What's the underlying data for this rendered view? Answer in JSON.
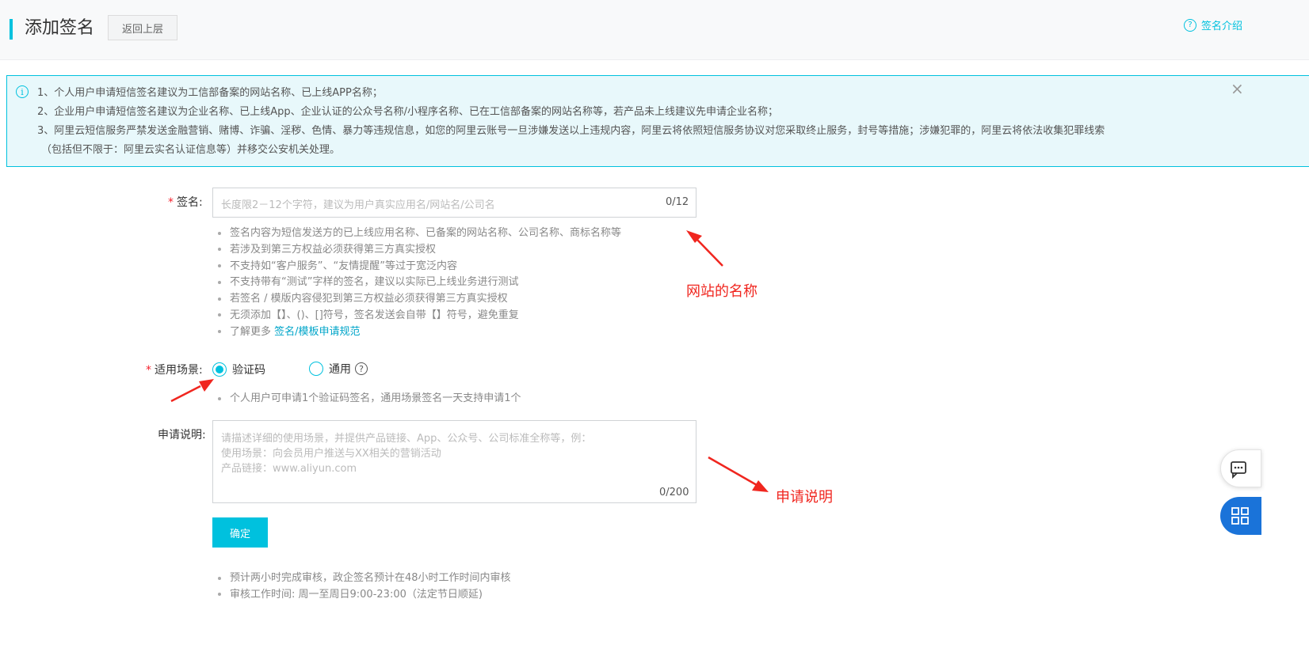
{
  "header": {
    "title": "添加签名",
    "back_label": "返回上层",
    "intro_icon": "question-circle-icon",
    "intro_label": "签名介绍"
  },
  "notice": {
    "lines": [
      "1、个人用户申请短信签名建议为工信部备案的网站名称、已上线APP名称；",
      "2、企业用户申请短信签名建议为企业名称、已上线App、企业认证的公众号名称/小程序名称、已在工信部备案的网站名称等，若产品未上线建议先申请企业名称；",
      "3、阿里云短信服务严禁发送金融营销、赌博、诈骗、淫秽、色情、暴力等违规信息，如您的阿里云账号一旦涉嫌发送以上违规内容，阿里云将依照短信服务协议对您采取终止服务，封号等措施；涉嫌犯罪的，阿里云将依法收集犯罪线索",
      "（包括但不限于：阿里云实名认证信息等）并移交公安机关处理。"
    ],
    "info_icon": "i",
    "close_icon": "×"
  },
  "form": {
    "required_mark": "*",
    "signature": {
      "label": "签名:",
      "placeholder": "长度限2－12个字符，建议为用户真实应用名/网站名/公司名",
      "counter": "0/12",
      "tips": [
        "签名内容为短信发送方的已上线应用名称、已备案的网站名称、公司名称、商标名称等",
        "若涉及到第三方权益必须获得第三方真实授权",
        "不支持如“客户服务”、“友情提醒”等过于宽泛内容",
        "不支持带有“测试”字样的签名，建议以实际已上线业务进行测试",
        "若签名 / 模版内容侵犯到第三方权益必须获得第三方真实授权",
        "无须添加【】、()、[]符号，签名发送会自带【】符号，避免重复"
      ],
      "more_prefix": "了解更多 ",
      "more_link": "签名/模板申请规范"
    },
    "scene": {
      "label": "适用场景:",
      "option1": "验证码",
      "option2": "通用",
      "help": "?",
      "tip": "个人用户可申请1个验证码签名，通用场景签名一天支持申请1个"
    },
    "description": {
      "label": "申请说明:",
      "placeholder_lines": [
        "请描述详细的使用场景，并提供产品链接、App、公众号、公司标准全称等，例：",
        "使用场景：向会员用户推送与XX相关的营销活动",
        "产品链接：www.aliyun.com"
      ],
      "counter": "0/200"
    },
    "confirm_label": "确定",
    "bottom_tips": [
      "预计两小时完成审核，政企签名预计在48小时工作时间内审核",
      "审核工作时间: 周一至周日9:00-23:00（法定节日顺延)"
    ]
  },
  "annotations": {
    "site_name": "网站的名称",
    "apply_desc": "申请说明"
  },
  "colors": {
    "accent": "#00c1de",
    "annotation": "#f0261f",
    "side_button": "#1a73d9"
  }
}
